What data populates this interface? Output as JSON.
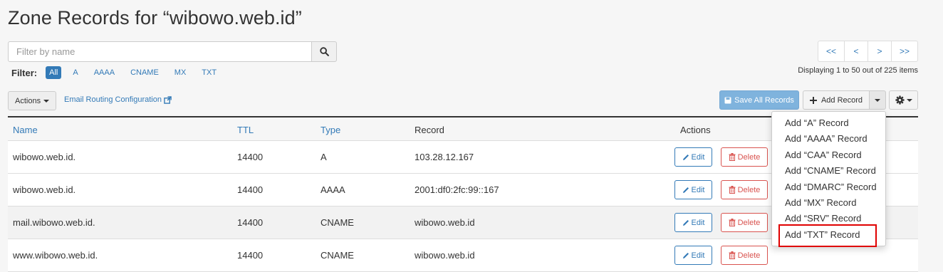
{
  "page": {
    "title": "Zone Records for “wibowo.web.id”"
  },
  "search": {
    "placeholder": "Filter by name",
    "icon": "search-icon"
  },
  "filter": {
    "label": "Filter:",
    "options": [
      {
        "label": "All",
        "active": true
      },
      {
        "label": "A",
        "active": false
      },
      {
        "label": "AAAA",
        "active": false
      },
      {
        "label": "CNAME",
        "active": false
      },
      {
        "label": "MX",
        "active": false
      },
      {
        "label": "TXT",
        "active": false
      }
    ]
  },
  "pagination": {
    "first": "<<",
    "prev": "<",
    "next": ">",
    "last": ">>",
    "status": "Displaying 1 to 50 out of 225 items"
  },
  "toolbar": {
    "actions_label": "Actions",
    "email_routing_label": "Email Routing Configuration",
    "save_all_label": "Save All Records",
    "add_record_label": "Add Record"
  },
  "table": {
    "columns": {
      "name": "Name",
      "ttl": "TTL",
      "type": "Type",
      "record": "Record",
      "actions": "Actions"
    },
    "edit_label": "Edit",
    "delete_label": "Delete",
    "rows": [
      {
        "name": "wibowo.web.id.",
        "ttl": "14400",
        "type": "A",
        "record": "103.28.12.167"
      },
      {
        "name": "wibowo.web.id.",
        "ttl": "14400",
        "type": "AAAA",
        "record": "2001:df0:2fc:99::167"
      },
      {
        "name": "mail.wibowo.web.id.",
        "ttl": "14400",
        "type": "CNAME",
        "record": "wibowo.web.id"
      },
      {
        "name": "www.wibowo.web.id.",
        "ttl": "14400",
        "type": "CNAME",
        "record": "wibowo.web.id"
      }
    ]
  },
  "add_menu": {
    "items": [
      "Add “A” Record",
      "Add “AAAA” Record",
      "Add “CAA” Record",
      "Add “CNAME” Record",
      "Add “DMARC” Record",
      "Add “MX” Record",
      "Add “SRV” Record",
      "Add “TXT” Record"
    ],
    "highlighted_index": 7
  },
  "colors": {
    "link": "#337ab7",
    "danger": "#d9534f",
    "save_button": "#7fb3dd",
    "highlight_box": "#e00000"
  }
}
